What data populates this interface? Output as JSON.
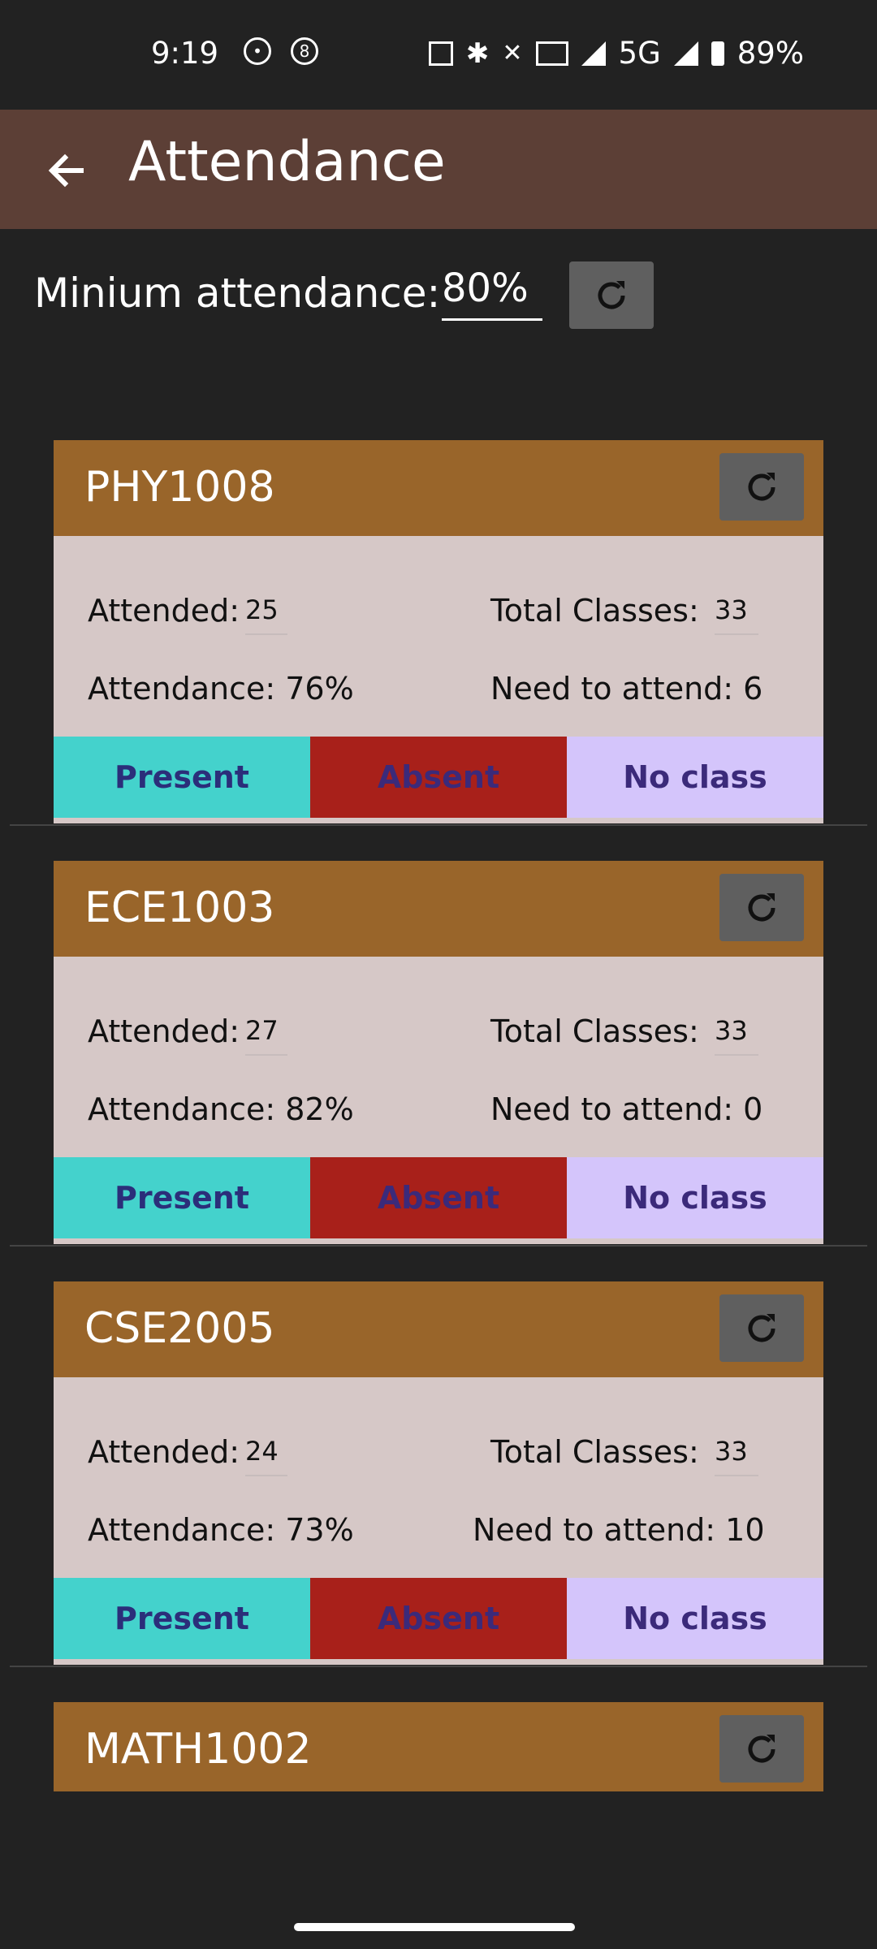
{
  "status_bar": {
    "time": "9:19",
    "network": "5G",
    "battery": "89%",
    "icons": [
      "cat-notification-icon",
      "8-ball-notification-icon",
      "nfc-icon",
      "bluetooth-icon",
      "vibrate-off-icon",
      "volte-icon",
      "signal-icon",
      "battery-icon"
    ]
  },
  "app_bar": {
    "title": "Attendance"
  },
  "minimum": {
    "label": "Minium attendance:",
    "value": "80%"
  },
  "cards": [
    {
      "code": "PHY1008",
      "attended_label": "Attended:",
      "attended": "25",
      "total_label": "Total Classes:",
      "total": "33",
      "attendance_text": "Attendance: 76%",
      "need_text": "Need to attend: 6"
    },
    {
      "code": "ECE1003",
      "attended_label": "Attended:",
      "attended": "27",
      "total_label": "Total Classes:",
      "total": "33",
      "attendance_text": "Attendance: 82%",
      "need_text": "Need to attend: 0"
    },
    {
      "code": "CSE2005",
      "attended_label": "Attended:",
      "attended": "24",
      "total_label": "Total Classes:",
      "total": "33",
      "attendance_text": "Attendance: 73%",
      "need_text": "Need to attend: 10"
    },
    {
      "code": "MATH1002"
    }
  ],
  "buttons": {
    "present": "Present",
    "absent": "Absent",
    "no_class": "No class"
  },
  "colors": {
    "app_bar": "#5c3f36",
    "card_header": "#99652a",
    "card_body": "#d6c8c7",
    "present": "#44d2cc",
    "absent": "#a8201a",
    "no_class": "#d4c5fb",
    "background": "#222222"
  }
}
